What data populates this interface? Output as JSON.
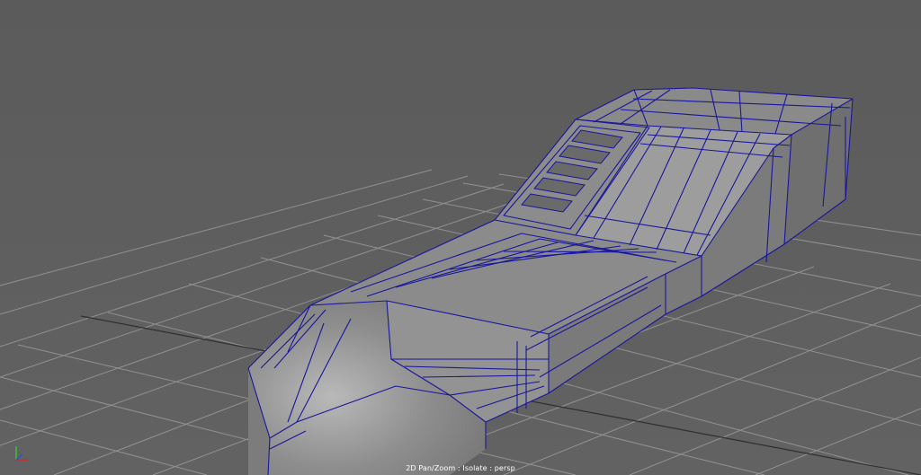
{
  "viewport": {
    "status_text": "2D Pan/Zoom : Isolate : persp",
    "camera": "persp",
    "background_color": "#5d5d5d",
    "grid_color": "#9a9a9a",
    "grid_axis_color": "#2f2f2f",
    "wireframe_color": "#18169c",
    "axis_colors": {
      "x": "#d62a2a",
      "y": "#2ed02e",
      "z": "#2a4fd6"
    }
  }
}
